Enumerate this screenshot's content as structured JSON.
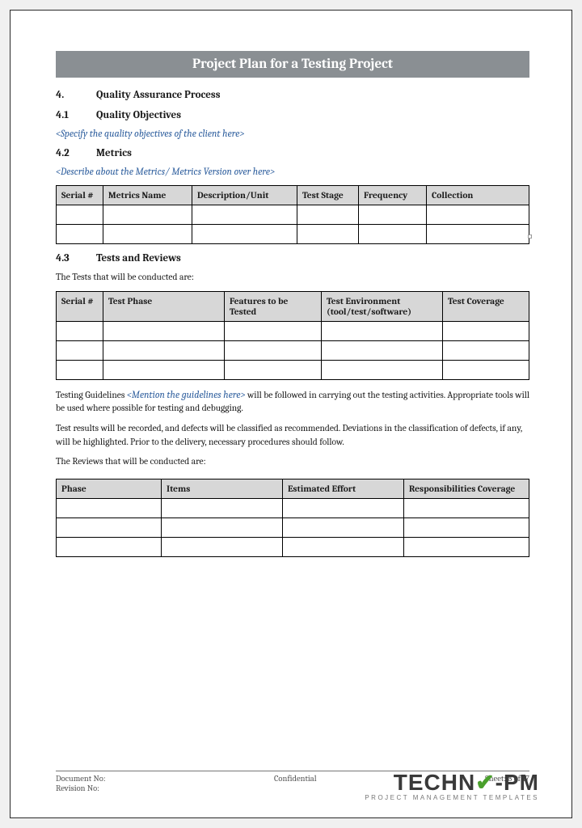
{
  "title": "Project Plan for a Testing Project",
  "sections": {
    "s4": {
      "num": "4.",
      "title": "Quality Assurance Process"
    },
    "s41": {
      "num": "4.1",
      "title": "Quality Objectives"
    },
    "s42": {
      "num": "4.2",
      "title": "Metrics"
    },
    "s43": {
      "num": "4.3",
      "title": "Tests and Reviews"
    }
  },
  "placeholders": {
    "p41": "<Specify the quality objectives of the client here>",
    "p42": "<Describe about the Metrics/ Metrics Version over here>",
    "guidelines": "<Mention the guidelines here>"
  },
  "body": {
    "tests_intro": "The Tests that will be conducted are:",
    "guidelines_pre": "Testing Guidelines ",
    "guidelines_post": " will be followed in carrying out the testing activities. Appropriate tools will be used where possible for testing and debugging.",
    "results_para": "Test results will be recorded, and defects will be classified as recommended. Deviations in the classification of defects, if any, will be highlighted. Prior to the delivery, necessary procedures should follow.",
    "reviews_intro": "The Reviews that will be conducted are:"
  },
  "tables": {
    "metrics_headers": [
      "Serial #",
      "Metrics Name",
      "Description/Unit",
      "Test Stage",
      "Frequency",
      "Collection"
    ],
    "tests_headers": [
      "Serial #",
      "Test Phase",
      "Features to be Tested",
      "Test Environment (tool/test/software)",
      "Test Coverage"
    ],
    "reviews_headers": [
      "Phase",
      "Items",
      "Estimated Effort",
      "Responsibilities Coverage"
    ]
  },
  "footer": {
    "docno": "Document No:",
    "revno": "Revision No:",
    "center": "Confidential",
    "sheet": "Sheet: 8 of 17"
  },
  "logo": {
    "pre": "TECHN",
    "check": "O",
    "post": "-PM",
    "sub": "PROJECT MANAGEMENT TEMPLATES"
  }
}
